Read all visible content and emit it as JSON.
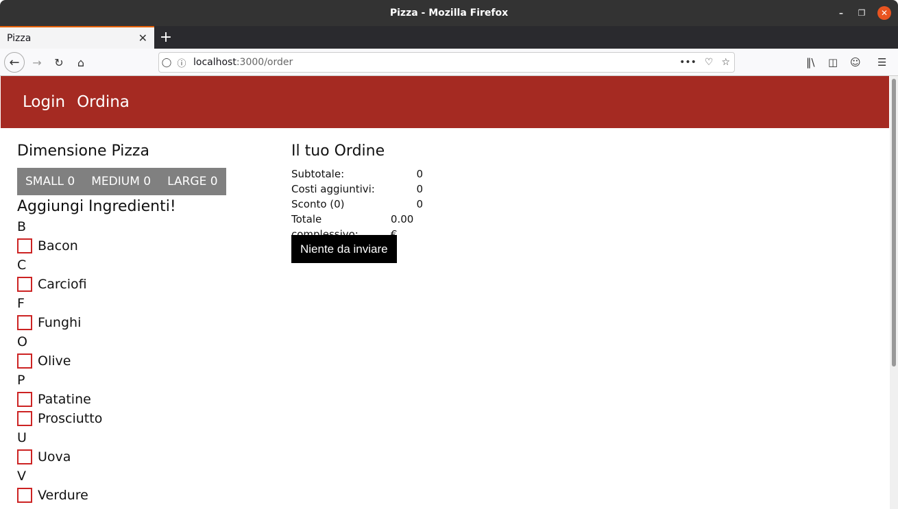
{
  "window": {
    "title": "Pizza - Mozilla Firefox"
  },
  "tab": {
    "label": "Pizza"
  },
  "url": {
    "host": "localhost",
    "path": ":3000/order"
  },
  "nav": {
    "login": "Login",
    "order": "Ordina"
  },
  "size_section": {
    "heading": "Dimensione Pizza",
    "options": [
      "SMALL 0",
      "MEDIUM 0",
      "LARGE 0"
    ]
  },
  "ingredients": {
    "heading": "Aggiungi Ingredienti!",
    "groups": [
      {
        "letter": "B",
        "items": [
          "Bacon"
        ]
      },
      {
        "letter": "C",
        "items": [
          "Carciofi"
        ]
      },
      {
        "letter": "F",
        "items": [
          "Funghi"
        ]
      },
      {
        "letter": "O",
        "items": [
          "Olive"
        ]
      },
      {
        "letter": "P",
        "items": [
          "Patatine",
          "Prosciutto"
        ]
      },
      {
        "letter": "U",
        "items": [
          "Uova"
        ]
      },
      {
        "letter": "V",
        "items": [
          "Verdure"
        ]
      }
    ]
  },
  "order": {
    "heading": "Il tuo Ordine",
    "rows": [
      {
        "label": "Subtotale:",
        "value": "0"
      },
      {
        "label": "Costi aggiuntivi:",
        "value": "0"
      },
      {
        "label": "Sconto (0)",
        "value": "0"
      },
      {
        "label": "Totale complessivo:",
        "value": "0.00 €"
      }
    ],
    "submit_label": "Niente da inviare"
  },
  "colors": {
    "header": "#a52a22",
    "size_bar": "#808080",
    "checkbox_border": "#cc2222",
    "button": "#000000"
  }
}
